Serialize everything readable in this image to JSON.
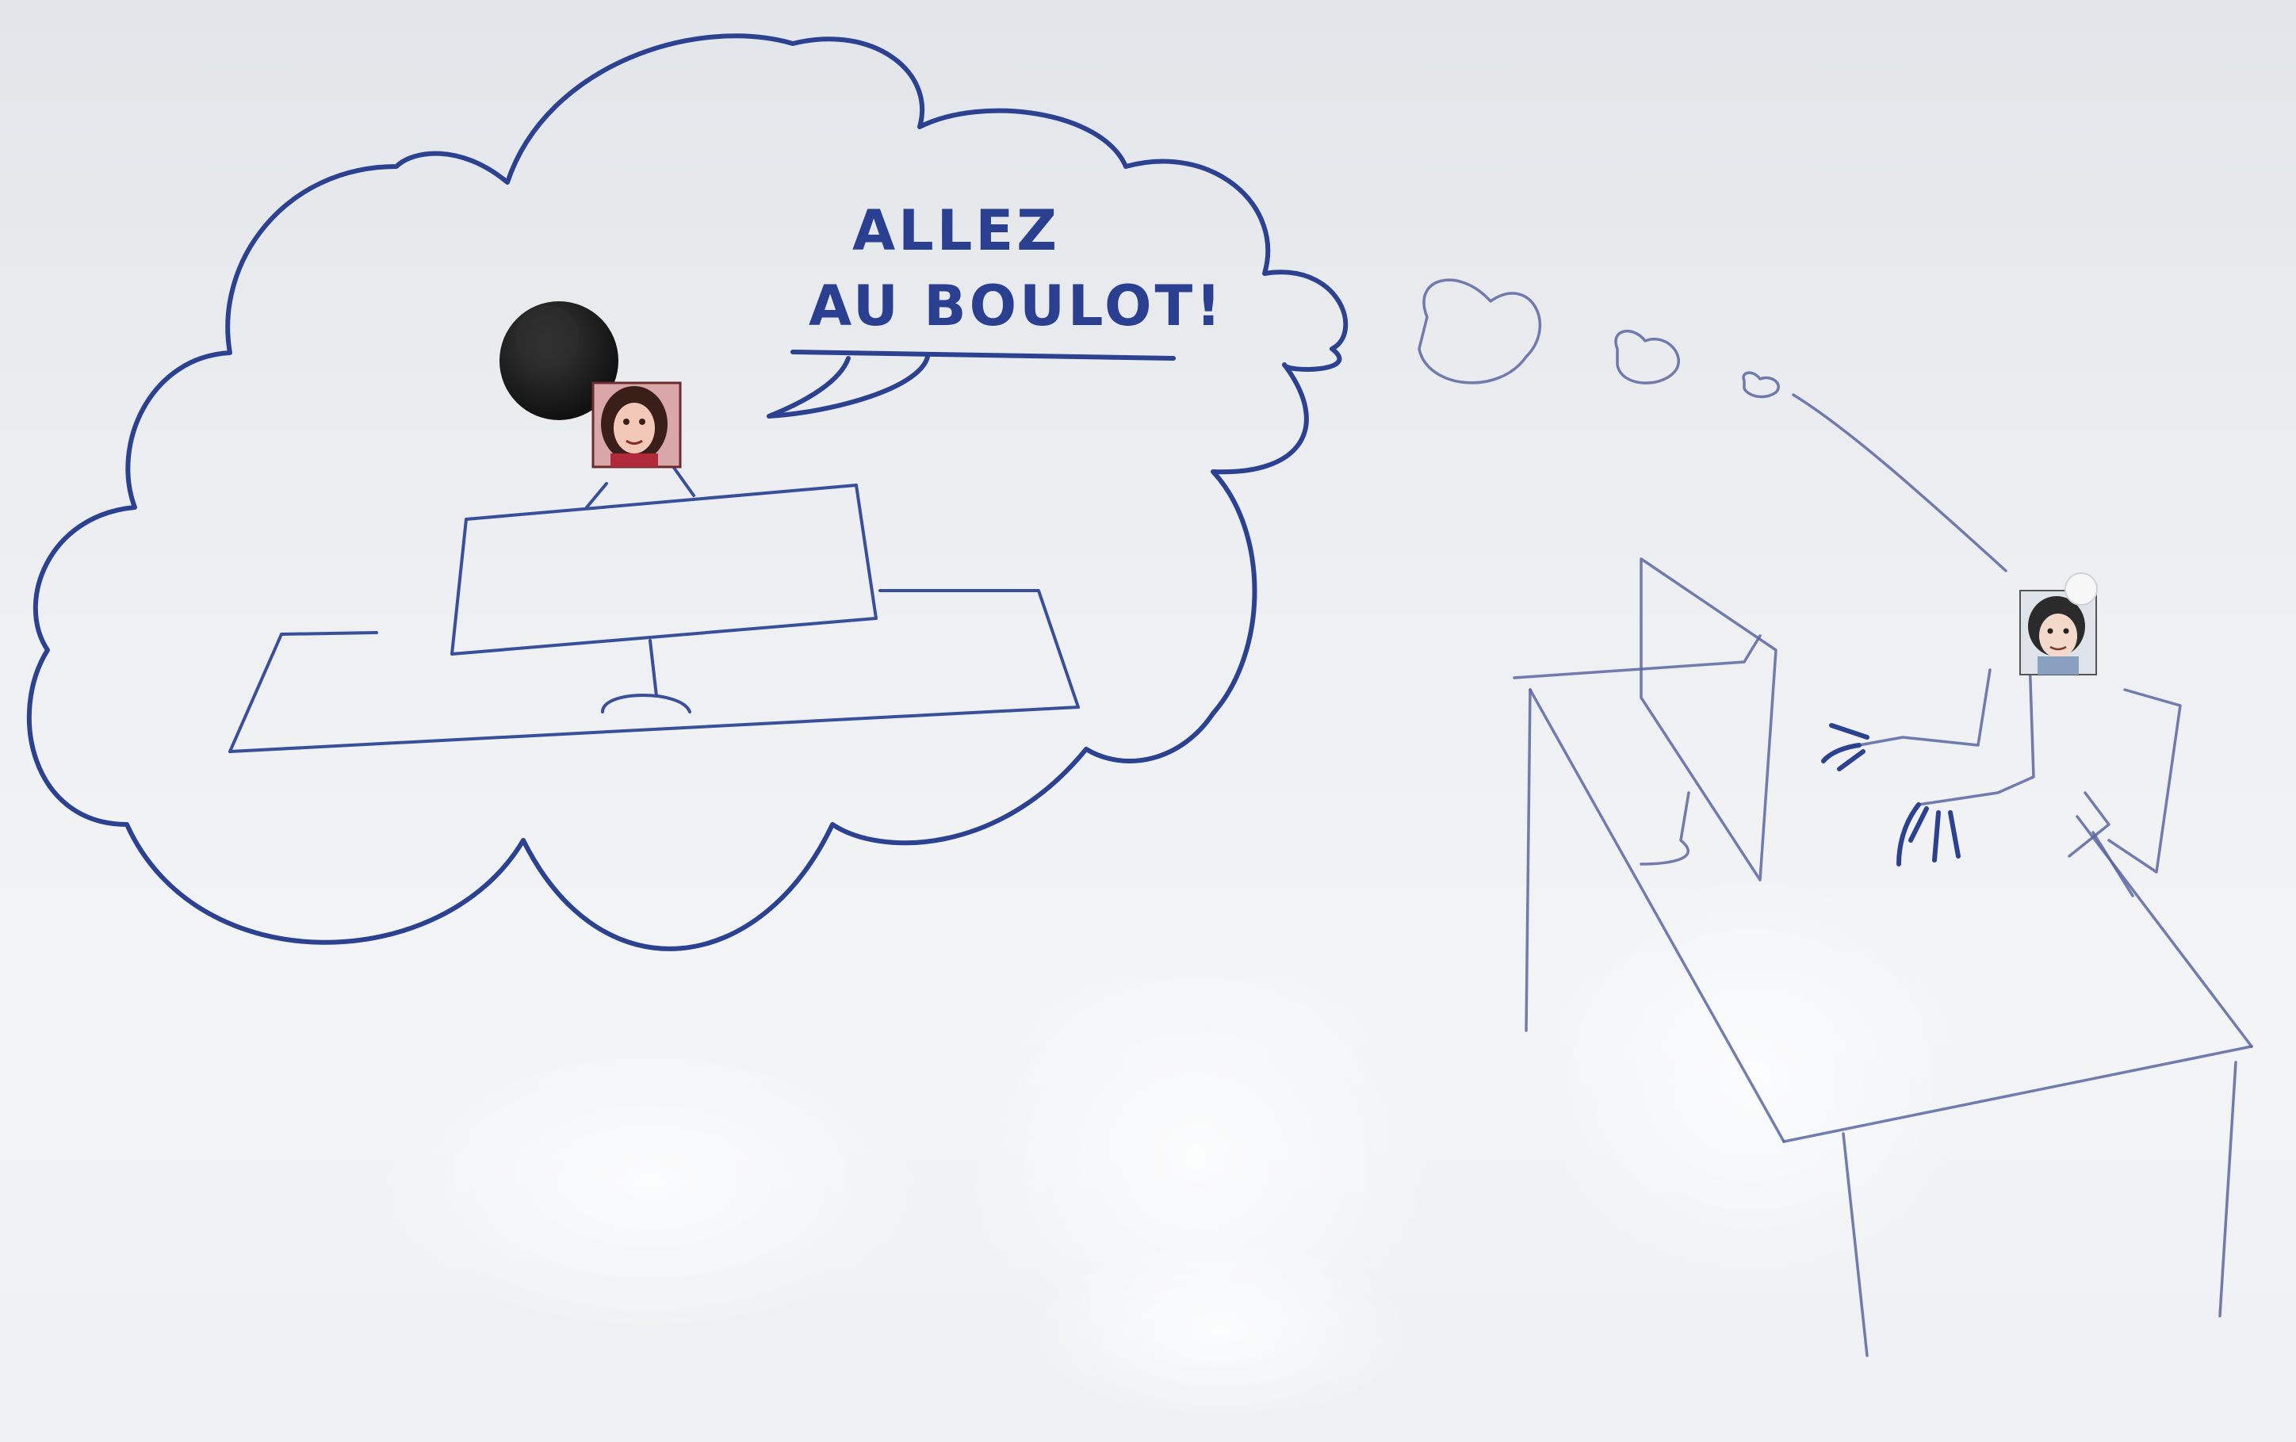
{
  "speech": {
    "line1": "ALLEZ",
    "line2": "AU BOULOT!"
  },
  "colors": {
    "ink": "#2c4290",
    "board": "#eceef1",
    "magnet": "#1b1b1b"
  },
  "objects": {
    "magnet": "black-round-magnet",
    "photo_left": "woman-avatar-sticker",
    "photo_right": "man-avatar-sticker"
  }
}
